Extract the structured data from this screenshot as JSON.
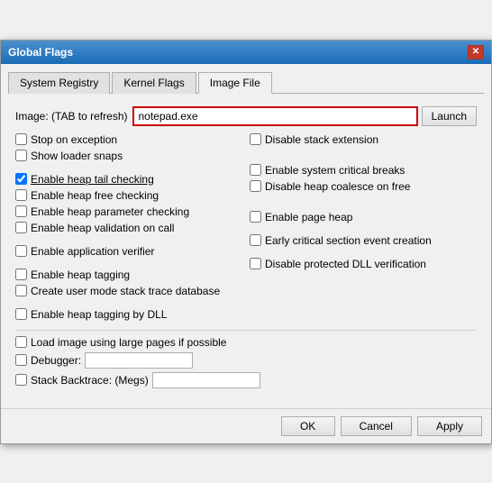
{
  "window": {
    "title": "Global Flags",
    "close_label": "✕"
  },
  "tabs": [
    {
      "id": "system-registry",
      "label": "System Registry",
      "active": false
    },
    {
      "id": "kernel-flags",
      "label": "Kernel Flags",
      "active": false
    },
    {
      "id": "image-file",
      "label": "Image File",
      "active": true
    }
  ],
  "image_section": {
    "label": "Image: (TAB to refresh)",
    "input_value": "notepad.exe",
    "launch_label": "Launch"
  },
  "left_checkboxes": [
    {
      "id": "stop-exception",
      "label": "Stop on exception",
      "checked": false
    },
    {
      "id": "show-loader",
      "label": "Show loader snaps",
      "checked": false
    },
    {
      "id": "sep1",
      "type": "separator"
    },
    {
      "id": "heap-tail",
      "label": "Enable heap tail checking",
      "checked": true,
      "underline": true
    },
    {
      "id": "heap-free",
      "label": "Enable heap free checking",
      "checked": false
    },
    {
      "id": "heap-param",
      "label": "Enable heap parameter checking",
      "checked": false
    },
    {
      "id": "heap-validation",
      "label": "Enable heap validation on call",
      "checked": false
    },
    {
      "id": "sep2",
      "type": "separator"
    },
    {
      "id": "app-verifier",
      "label": "Enable application verifier",
      "checked": false
    },
    {
      "id": "sep3",
      "type": "separator"
    },
    {
      "id": "heap-tagging",
      "label": "Enable heap tagging",
      "checked": false
    },
    {
      "id": "user-mode-stack",
      "label": "Create user mode stack trace database",
      "checked": false
    },
    {
      "id": "sep4",
      "type": "separator"
    },
    {
      "id": "heap-tagging-dll",
      "label": "Enable heap tagging by DLL",
      "checked": false
    }
  ],
  "right_checkboxes": [
    {
      "id": "disable-stack",
      "label": "Disable stack extension",
      "checked": false
    },
    {
      "id": "sep_r1",
      "type": "separator"
    },
    {
      "id": "sep_r2",
      "type": "separator"
    },
    {
      "id": "system-critical",
      "label": "Enable system critical breaks",
      "checked": false
    },
    {
      "id": "heap-coalesce",
      "label": "Disable heap coalesce on free",
      "checked": false
    },
    {
      "id": "sep_r3",
      "type": "separator"
    },
    {
      "id": "sep_r4",
      "type": "separator"
    },
    {
      "id": "page-heap",
      "label": "Enable page heap",
      "checked": false
    },
    {
      "id": "sep_r5",
      "type": "separator"
    },
    {
      "id": "early-critical",
      "label": "Early critical section event creation",
      "checked": false
    },
    {
      "id": "sep_r6",
      "type": "separator"
    },
    {
      "id": "disable-dll",
      "label": "Disable protected DLL verification",
      "checked": false
    }
  ],
  "bottom_checkboxes": [
    {
      "id": "large-pages",
      "label": "Load image using large pages if possible",
      "checked": false
    }
  ],
  "bottom_inputs": [
    {
      "id": "debugger",
      "label": "Debugger:",
      "value": ""
    },
    {
      "id": "stack-backtrace",
      "label": "Stack Backtrace: (Megs)",
      "value": ""
    }
  ],
  "footer_buttons": [
    {
      "id": "ok",
      "label": "OK"
    },
    {
      "id": "cancel",
      "label": "Cancel"
    },
    {
      "id": "apply",
      "label": "Apply"
    }
  ]
}
